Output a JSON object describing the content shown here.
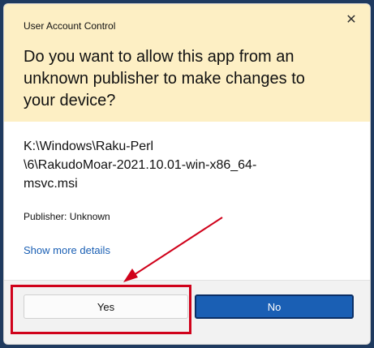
{
  "dialog": {
    "window_title": "User Account Control",
    "close_glyph": "✕",
    "question": "Do you want to allow this app from an unknown publisher to make changes to your device?",
    "file_path_line1": "K:\\Windows\\Raku-Perl",
    "file_path_line2": "\\6\\RakudoMoar-2021.10.01-win-x86_64-",
    "file_path_line3": "msvc.msi",
    "publisher": "Publisher: Unknown",
    "show_more_link": "Show more details",
    "buttons": {
      "yes": "Yes",
      "no": "No"
    }
  },
  "colors": {
    "header_bg": "#fdefc4",
    "primary_button": "#1a5fb4",
    "annotation": "#d0021b"
  }
}
